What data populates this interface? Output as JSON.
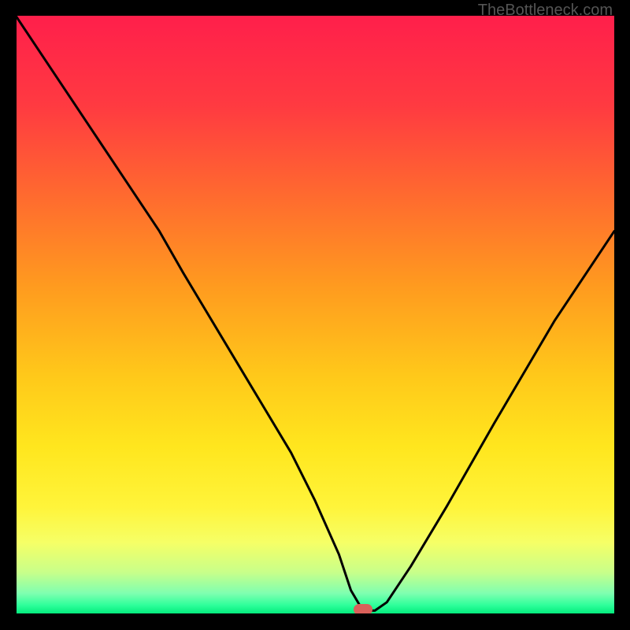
{
  "watermark": "TheBottleneck.com",
  "marker": {
    "color": "#d9605a",
    "x_pct": 58,
    "y_pct": 99.2
  },
  "chart_data": {
    "type": "line",
    "title": "",
    "xlabel": "",
    "ylabel": "",
    "xlim": [
      0,
      100
    ],
    "ylim": [
      0,
      100
    ],
    "grid": false,
    "series": [
      {
        "name": "bottleneck-curve",
        "x": [
          0,
          6,
          12,
          18,
          24,
          28,
          34,
          40,
          46,
          50,
          54,
          56,
          58,
          60,
          62,
          66,
          72,
          80,
          90,
          100
        ],
        "y": [
          100,
          91,
          82,
          73,
          64,
          57,
          47,
          37,
          27,
          19,
          10,
          4,
          0.6,
          0.6,
          2,
          8,
          18,
          32,
          49,
          64
        ]
      }
    ],
    "background_gradient": {
      "stops": [
        {
          "pos": 0.0,
          "color": "#ff1f4b"
        },
        {
          "pos": 0.15,
          "color": "#ff3a41"
        },
        {
          "pos": 0.3,
          "color": "#ff6a2f"
        },
        {
          "pos": 0.45,
          "color": "#ff9a1f"
        },
        {
          "pos": 0.6,
          "color": "#ffc81a"
        },
        {
          "pos": 0.72,
          "color": "#ffe61e"
        },
        {
          "pos": 0.82,
          "color": "#fff43a"
        },
        {
          "pos": 0.88,
          "color": "#f6ff66"
        },
        {
          "pos": 0.93,
          "color": "#c8ff8a"
        },
        {
          "pos": 0.965,
          "color": "#7fffb0"
        },
        {
          "pos": 0.985,
          "color": "#2eff9a"
        },
        {
          "pos": 1.0,
          "color": "#00e97a"
        }
      ]
    },
    "annotations": [
      {
        "type": "watermark",
        "text": "TheBottleneck.com",
        "position": "top-right"
      }
    ]
  }
}
